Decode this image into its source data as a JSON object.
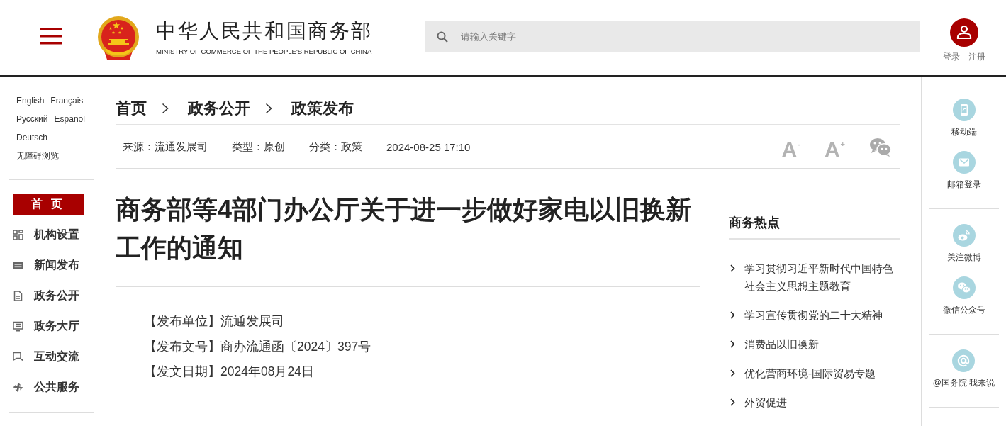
{
  "header": {
    "site_title": "中华人民共和国商务部",
    "site_subtitle": "MINISTRY OF COMMERCE OF THE PEOPLE'S REPUBLIC OF CHINA",
    "search": {
      "placeholder": "请输入关键字"
    },
    "account_links": [
      "登录",
      "注册"
    ]
  },
  "left_sidebar": {
    "languages": [
      "English",
      "Français",
      "Русский",
      "Español",
      "Deutsch"
    ],
    "accessibility_link": "无障碍浏览",
    "nav": [
      {
        "label": "首 页",
        "selected": true
      },
      {
        "label": "机构设置",
        "selected": false
      },
      {
        "label": "新闻发布",
        "selected": false
      },
      {
        "label": "政务公开",
        "selected": false
      },
      {
        "label": "政务大厅",
        "selected": false
      },
      {
        "label": "互动交流",
        "selected": false
      },
      {
        "label": "公共服务",
        "selected": false
      }
    ]
  },
  "breadcrumb": [
    "首页",
    "政务公开",
    "政策发布"
  ],
  "meta": [
    "来源：流通发展司",
    "类型：原创",
    "分类：政策",
    "2024-08-25 17:10"
  ],
  "font_size_buttons": [
    "A$^{-}$",
    "A$^{+}$"
  ],
  "article": {
    "title": "商务部等4部门办公厅关于进一步做好家电以旧换新工作的通知",
    "details": [
      "【发布单位】流通发展司",
      "【发布文号】商办流通函〔2024〕397号",
      "【发文日期】2024年08月24日"
    ]
  },
  "hot_topics": {
    "title": "商务热点",
    "items": [
      "学习贯彻习近平新时代中国特色社会主义思想主题教育",
      "学习宣传贯彻党的二十大精神",
      "消费品以旧换新",
      "优化营商环境-国际贸易专题",
      "外贸促进"
    ]
  },
  "quick_links": [
    [
      "移动端",
      "邮箱登录"
    ],
    [
      "关注微博",
      "微信公众号"
    ],
    [
      "@国务院 我来说"
    ]
  ]
}
